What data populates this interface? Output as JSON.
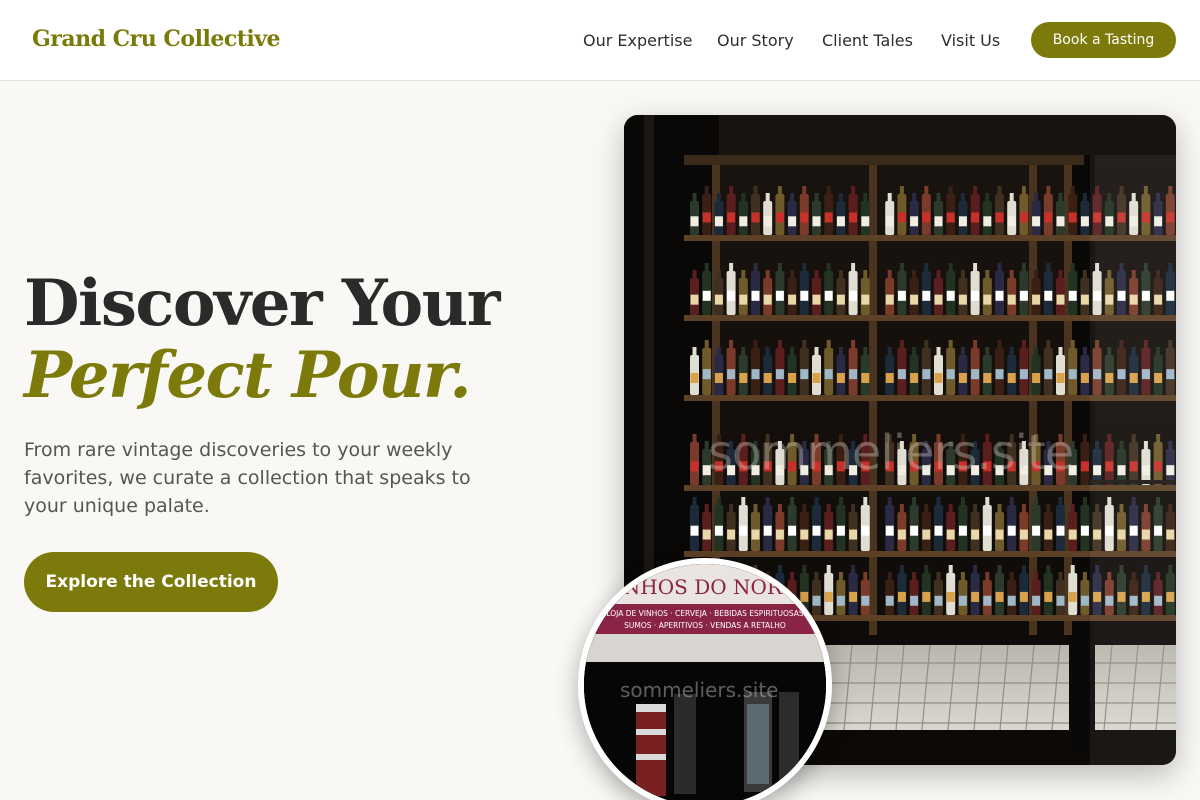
{
  "header": {
    "brand": "Grand Cru Collective",
    "nav": [
      "Our Expertise",
      "Our Story",
      "Client Tales",
      "Visit Us"
    ],
    "cta": "Book a Tasting"
  },
  "hero": {
    "title_line1": "Discover Your",
    "title_line2": "Perfect Pour.",
    "description": "From rare vintage discoveries to your weekly favorites, we curate a collection that speaks to your unique palate.",
    "cta": "Explore the Collection"
  },
  "images": {
    "main_watermark": "sommeliers.site",
    "circle_watermark": "sommeliers.site",
    "storefront_sign": "VINHOS DO NORTE",
    "storefront_line1": "LOJA DE VINHOS · CERVEJA · BEBIDAS ESPIRITUOSAS",
    "storefront_line2": "SUMOS · APERITIVOS · VENDAS A RETALHO"
  },
  "colors": {
    "accent": "#7b7a0a",
    "background": "#f9f8f5"
  }
}
